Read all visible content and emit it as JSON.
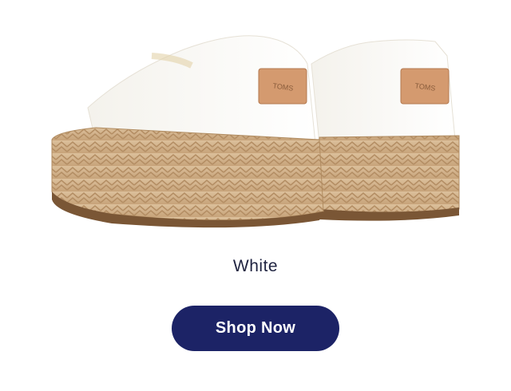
{
  "product": {
    "image_label": "white espadrille platform sneakers",
    "tag_text": "TOMS",
    "color_name": "White"
  },
  "cta": {
    "label": "Shop Now"
  },
  "colors": {
    "button_bg": "#1c2366",
    "button_text": "#ffffff",
    "label_text": "#1f2340",
    "canvas_text": "#1f2340",
    "canvas_white": "#f7f5f0",
    "jute": "#cfae84",
    "tag_leather": "#d49a6f"
  }
}
